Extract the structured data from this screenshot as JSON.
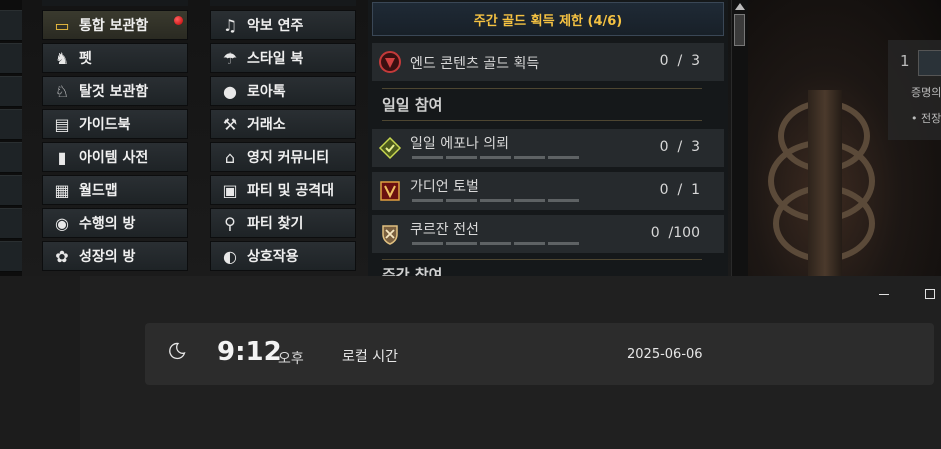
{
  "game": {
    "menu_col1": [
      {
        "label": "통합 보관함",
        "icon": "chest-icon",
        "active": true,
        "alert": true
      },
      {
        "label": "펫",
        "icon": "pet-icon"
      },
      {
        "label": "탈것 보관함",
        "icon": "horse-icon"
      },
      {
        "label": "가이드북",
        "icon": "guidebook-icon"
      },
      {
        "label": "아이템 사전",
        "icon": "book-icon"
      },
      {
        "label": "월드맵",
        "icon": "map-icon"
      },
      {
        "label": "수행의 방",
        "icon": "person-icon"
      },
      {
        "label": "성장의 방",
        "icon": "growth-icon"
      }
    ],
    "menu_col2": [
      {
        "label": "악보 연주",
        "icon": "lute-icon"
      },
      {
        "label": "스타일 북",
        "icon": "hat-icon"
      },
      {
        "label": "로아톡",
        "icon": "chat-icon"
      },
      {
        "label": "거래소",
        "icon": "gavel-icon"
      },
      {
        "label": "영지 커뮤니티",
        "icon": "house-icon"
      },
      {
        "label": "파티 및 공격대",
        "icon": "party-icon"
      },
      {
        "label": "파티 찾기",
        "icon": "party-search-icon"
      },
      {
        "label": "상호작용",
        "icon": "interaction-icon"
      }
    ],
    "panel": {
      "weekly_title": "주간 골드 획득 제한 (4/6)",
      "end_content": {
        "name": "엔드 콘텐츠 골드 획득",
        "count": "0  /  3"
      },
      "daily_header": "일일 참여",
      "daily": [
        {
          "name": "일일 에포나 의뢰",
          "count": "0  /  3",
          "icon": "epona-icon"
        },
        {
          "name": "가디언 토벌",
          "count": "0  /  1",
          "icon": "guardian-icon"
        },
        {
          "name": "쿠르잔 전선",
          "count": "0  /100",
          "icon": "kurzan-icon"
        }
      ],
      "weekly_header": "주간 참여"
    },
    "art": {
      "num": "1",
      "text1": "증명의",
      "text2": "• 전장"
    }
  },
  "clock": {
    "time": "9:12",
    "ampm": "오후",
    "timezone": "로컬 시간",
    "date": "2025-06-06"
  }
}
